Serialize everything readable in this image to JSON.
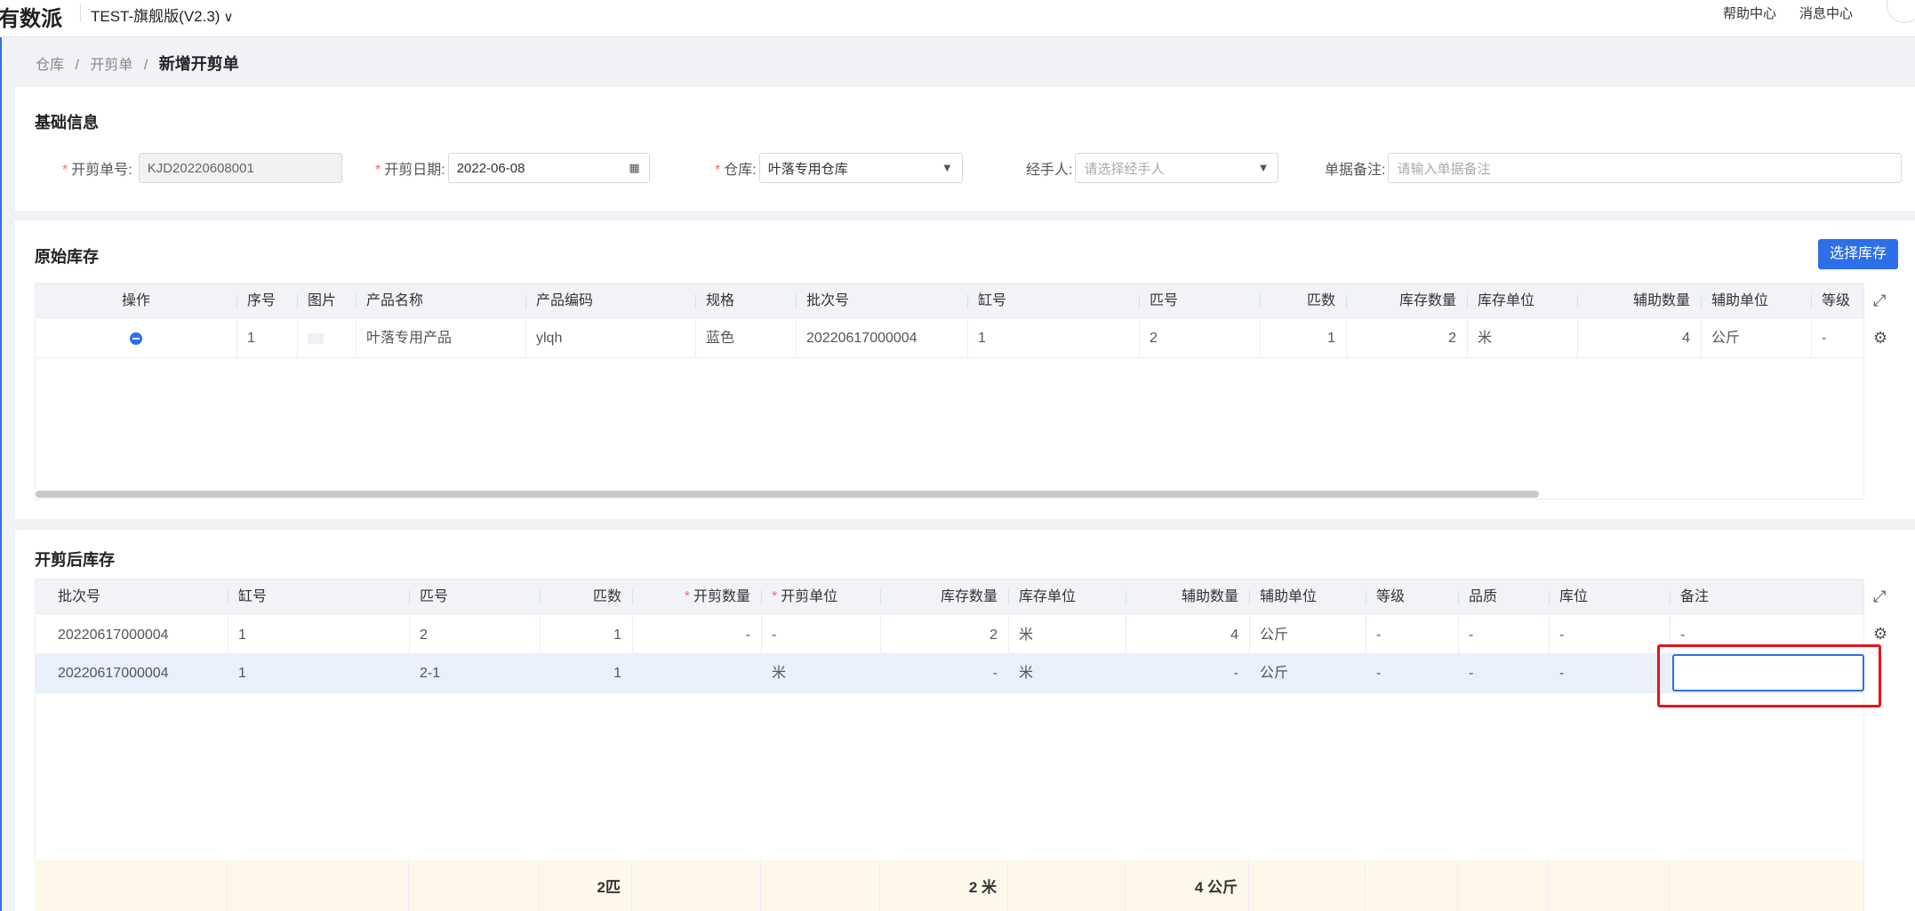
{
  "header": {
    "logo": "有数派",
    "version": "TEST-旗舰版(V2.3)",
    "version_icon": "chevron-down-icon",
    "help": "帮助中心",
    "messages": "消息中心"
  },
  "breadcrumb": {
    "items": [
      "仓库",
      "/",
      "开剪单",
      "/"
    ],
    "current": "新增开剪单"
  },
  "basic": {
    "title": "基础信息",
    "order_no": {
      "label": "开剪单号:",
      "value": "KJD20220608001"
    },
    "date": {
      "label": "开剪日期:",
      "value": "2022-06-08"
    },
    "warehouse": {
      "label": "仓库:",
      "value": "叶落专用仓库"
    },
    "handler": {
      "label": "经手人:",
      "placeholder": "请选择经手人"
    },
    "remark": {
      "label": "单据备注:",
      "placeholder": "请输入单据备注"
    }
  },
  "original": {
    "title": "原始库存",
    "select_button": "选择库存",
    "columns": [
      "操作",
      "序号",
      "图片",
      "产品名称",
      "产品编码",
      "规格",
      "批次号",
      "缸号",
      "匹号",
      "匹数",
      "库存数量",
      "库存单位",
      "辅助数量",
      "辅助单位",
      "等级"
    ],
    "rows": [
      {
        "seq": "1",
        "name": "叶落专用产品",
        "code": "ylqh",
        "spec": "蓝色",
        "batch": "20220617000004",
        "vat": "1",
        "piece_no": "2",
        "pieces": "1",
        "stock_qty": "2",
        "stock_unit": "米",
        "aux_qty": "4",
        "aux_unit": "公斤",
        "grade": "-"
      }
    ]
  },
  "after": {
    "title": "开剪后库存",
    "columns": [
      "批次号",
      "缸号",
      "匹号",
      "匹数",
      "开剪数量",
      "开剪单位",
      "库存数量",
      "库存单位",
      "辅助数量",
      "辅助单位",
      "等级",
      "品质",
      "库位",
      "备注"
    ],
    "rows": [
      {
        "batch": "20220617000004",
        "vat": "1",
        "piece_no": "2",
        "pieces": "1",
        "cut_qty": "-",
        "cut_unit": "-",
        "stock_qty": "2",
        "stock_unit": "米",
        "aux_qty": "4",
        "aux_unit": "公斤",
        "grade": "-",
        "quality": "-",
        "location": "-",
        "remark": "-"
      },
      {
        "batch": "20220617000004",
        "vat": "1",
        "piece_no": "2-1",
        "pieces": "1",
        "cut_qty": "",
        "cut_unit": "米",
        "stock_qty": "-",
        "stock_unit": "米",
        "aux_qty": "-",
        "aux_unit": "公斤",
        "grade": "-",
        "quality": "-",
        "location": "-",
        "remark": ""
      }
    ],
    "summary": {
      "pieces": "2匹",
      "stock": "2 米",
      "aux": "4 公斤"
    }
  },
  "colors": {
    "primary": "#2d6fe8",
    "required": "#f56c6c",
    "highlight_box": "#e8141a",
    "summary_bg": "#fdf8ea"
  }
}
